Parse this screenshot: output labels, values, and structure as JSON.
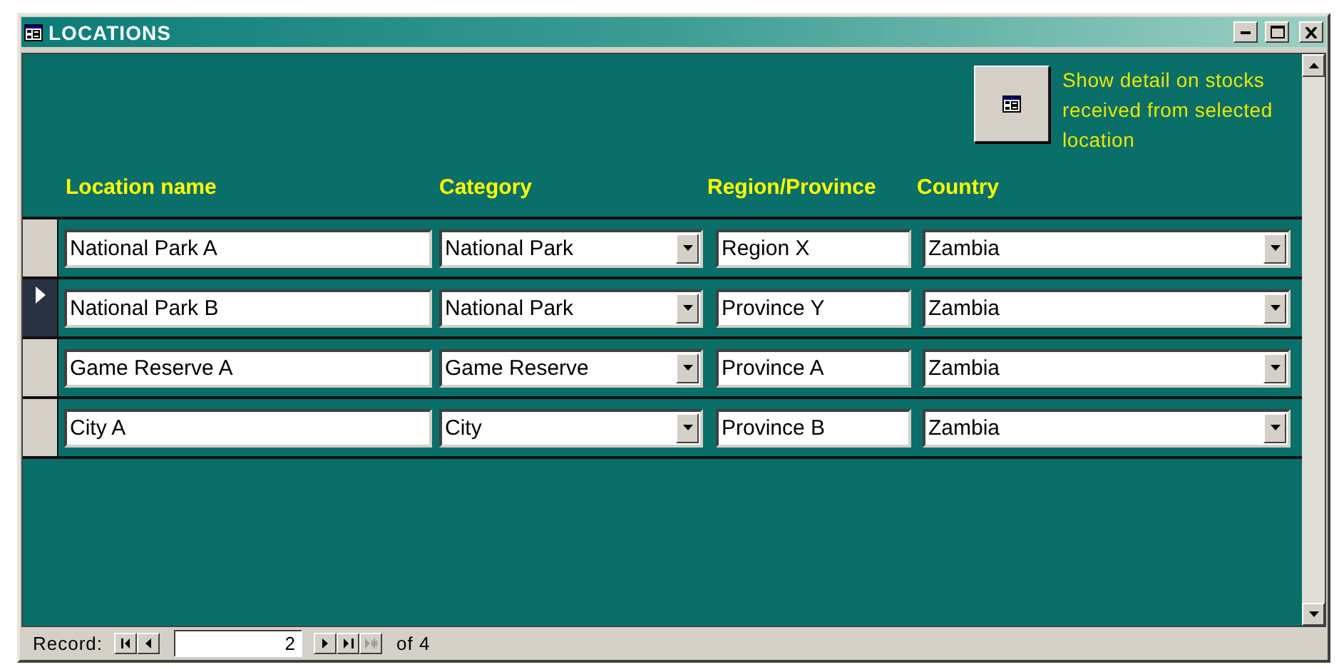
{
  "window": {
    "title": "LOCATIONS"
  },
  "detail_button": {
    "caption": "Show detail on stocks received from selected location"
  },
  "columns": [
    "Location name",
    "Category",
    "Region/Province",
    "Country"
  ],
  "rows": [
    {
      "name": "National Park A",
      "category": "National Park",
      "region": "Region X",
      "country": "Zambia",
      "selected": false
    },
    {
      "name": "National Park B",
      "category": "National Park",
      "region": "Province Y",
      "country": "Zambia",
      "selected": true
    },
    {
      "name": "Game Reserve A",
      "category": "Game Reserve",
      "region": "Province A",
      "country": "Zambia",
      "selected": false
    },
    {
      "name": "City A",
      "category": "City",
      "region": "Province B",
      "country": "Zambia",
      "selected": false
    }
  ],
  "navigator": {
    "label": "Record:",
    "current": "2",
    "total": "of 4",
    "buttons": [
      {
        "kind": "first",
        "disabled": false
      },
      {
        "kind": "previous",
        "disabled": false
      },
      {
        "kind": "next",
        "disabled": false
      },
      {
        "kind": "last",
        "disabled": false
      },
      {
        "kind": "new",
        "disabled": true
      }
    ]
  }
}
